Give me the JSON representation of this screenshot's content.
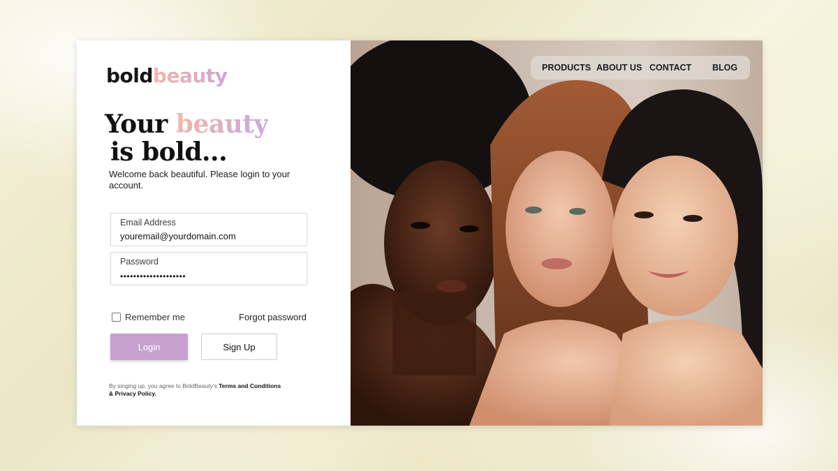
{
  "logo": {
    "part1": "bold",
    "part2": "beauty"
  },
  "headline": {
    "word1": "Your",
    "accent": "beauty",
    "line2": "is bold..."
  },
  "subtitle": "Welcome back beautiful. Please login to your account.",
  "form": {
    "email": {
      "label": "Email Address",
      "value": "youremail@yourdomain.com"
    },
    "password": {
      "label": "Password",
      "value": "••••••••••••••••••••"
    },
    "remember_label": "Remember me",
    "remember_checked": false,
    "forgot_label": "Forgot password",
    "login_label": "Login",
    "signup_label": "Sign Up"
  },
  "terms": {
    "prefix": "By singing up, you agree to BoldBeauty's",
    "link": "Terms and Conditions & Privacy Policy."
  },
  "nav": {
    "items": [
      "PRODUCTS",
      "ABOUT US",
      "CONTACT",
      "BLOG"
    ]
  },
  "colors": {
    "accent": "#c8a0cf",
    "accent_gradient_start": "#f1b8a8",
    "accent_gradient_end": "#c9a7dd"
  }
}
